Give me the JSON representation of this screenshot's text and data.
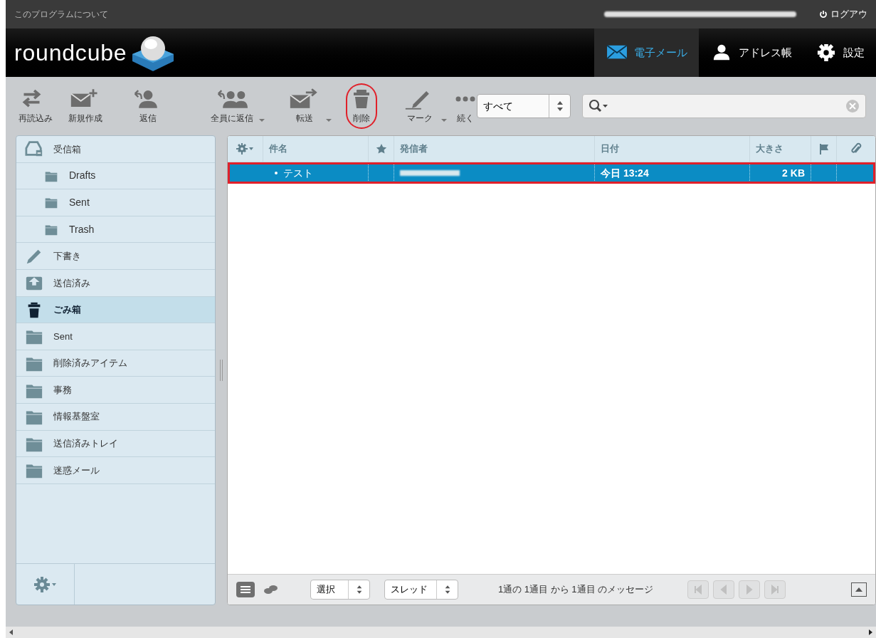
{
  "topbar": {
    "about": "このプログラムについて",
    "user_redacted": true,
    "logout": "ログアウ"
  },
  "header": {
    "logo": "roundcube",
    "nav": [
      {
        "kind": "mail",
        "label": "電子メール",
        "selected": true
      },
      {
        "kind": "contacts",
        "label": "アドレス帳",
        "selected": false
      },
      {
        "kind": "settings",
        "label": "設定",
        "selected": false
      }
    ]
  },
  "toolbar": {
    "buttons": [
      {
        "kind": "refresh",
        "label": "再読込み",
        "menu": false,
        "highlighted": false
      },
      {
        "kind": "compose",
        "label": "新規作成",
        "menu": false,
        "highlighted": false
      },
      {
        "kind": "reply",
        "label": "返信",
        "menu": false,
        "highlighted": false
      },
      {
        "kind": "replyall",
        "label": "全員に返信",
        "menu": true,
        "highlighted": false
      },
      {
        "kind": "forward",
        "label": "転送",
        "menu": true,
        "highlighted": false
      },
      {
        "kind": "delete",
        "label": "削除",
        "menu": false,
        "highlighted": true
      },
      {
        "kind": "mark",
        "label": "マーク",
        "menu": true,
        "highlighted": false
      },
      {
        "kind": "more",
        "label": "続く",
        "menu": false,
        "highlighted": false
      }
    ],
    "filter": "すべて"
  },
  "folders": [
    {
      "kind": "inbox",
      "label": "受信箱",
      "selected": false,
      "children": [
        {
          "kind": "folder",
          "label": "Drafts",
          "selected": false
        },
        {
          "kind": "folder",
          "label": "Sent",
          "selected": false
        },
        {
          "kind": "folder",
          "label": "Trash",
          "selected": false
        }
      ]
    },
    {
      "kind": "drafts",
      "label": "下書き",
      "selected": false
    },
    {
      "kind": "sent",
      "label": "送信済み",
      "selected": false
    },
    {
      "kind": "trash",
      "label": "ごみ箱",
      "selected": true
    },
    {
      "kind": "folder",
      "label": "Sent",
      "selected": false
    },
    {
      "kind": "folder",
      "label": "削除済みアイテム",
      "selected": false
    },
    {
      "kind": "folder",
      "label": "事務",
      "selected": false
    },
    {
      "kind": "folder",
      "label": "情報基盤室",
      "selected": false
    },
    {
      "kind": "folder",
      "label": "送信済みトレイ",
      "selected": false
    },
    {
      "kind": "folder",
      "label": "迷惑メール",
      "selected": false
    }
  ],
  "table": {
    "columns": [
      "件名",
      "発信者",
      "日付",
      "大きさ"
    ],
    "rows": [
      {
        "subject": "テスト",
        "sender_redacted": true,
        "date": "今日 13:24",
        "size": "2 KB",
        "selected": true,
        "highlighted": true
      }
    ]
  },
  "footer": {
    "select": "選択",
    "threads": "スレッド",
    "count": "1通の 1通目 から 1通目 のメッセージ"
  }
}
